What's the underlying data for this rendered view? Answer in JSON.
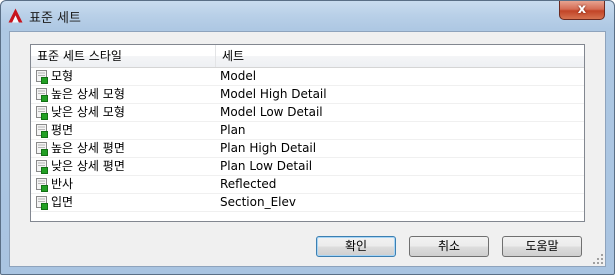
{
  "window": {
    "title": "표준 세트",
    "close_glyph": "x"
  },
  "list": {
    "columns": [
      "표준 세트 스타일",
      "세트"
    ],
    "rows": [
      {
        "style": "모형",
        "set": "Model"
      },
      {
        "style": "높은 상세 모형",
        "set": "Model High Detail"
      },
      {
        "style": "낮은 상세 모형",
        "set": "Model Low Detail"
      },
      {
        "style": "평면",
        "set": "Plan"
      },
      {
        "style": "높은 상세 평면",
        "set": "Plan High Detail"
      },
      {
        "style": "낮은 상세 평면",
        "set": "Plan Low Detail"
      },
      {
        "style": "반사",
        "set": "Reflected"
      },
      {
        "style": "입면",
        "set": "Section_Elev"
      }
    ],
    "row_icon": "display-set-icon"
  },
  "buttons": {
    "ok": "확인",
    "cancel": "취소",
    "help": "도움말"
  },
  "colors": {
    "title_bar": "#b9d0e8",
    "close_button": "#c24427",
    "icon_green": "#22a024"
  }
}
